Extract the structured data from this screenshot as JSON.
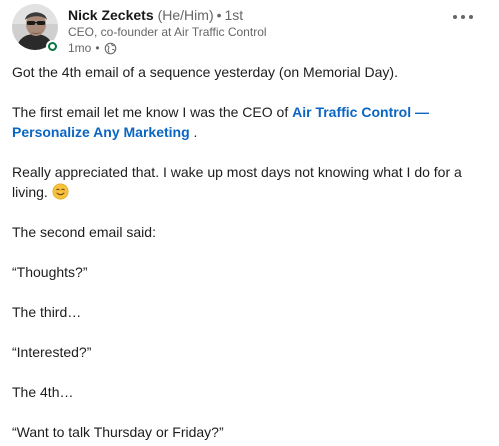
{
  "author": {
    "name": "Nick Zeckets",
    "pronouns": "(He/Him)",
    "separator": "•",
    "degree": "1st",
    "headline": "CEO, co-founder at Air Traffic Control",
    "time": "1mo",
    "time_separator": "•",
    "status_color": "#057642"
  },
  "menu": {
    "icon": "more-horizontal-icon",
    "glyph": "•••"
  },
  "post": {
    "p1": "Got the 4th email of a sequence yesterday (on Memorial Day).",
    "p2_prefix": "The first email let me know I was the CEO of ",
    "p2_link": "Air Traffic Control — Personalize Any Marketing",
    "p2_suffix": " .",
    "p3": "Really appreciated that. I wake up most days not knowing what I do for a living.",
    "p3_emoji": "smiling-face-emoji",
    "p4": "The second email said:",
    "p5": "“Thoughts?”",
    "p6": "The third…",
    "p7": "“Interested?”",
    "p8": "The 4th…",
    "p9": "“Want to talk Thursday or Friday?”"
  },
  "colors": {
    "link": "#0a66c2",
    "muted": "#666666",
    "text": "#1d1d1d"
  }
}
